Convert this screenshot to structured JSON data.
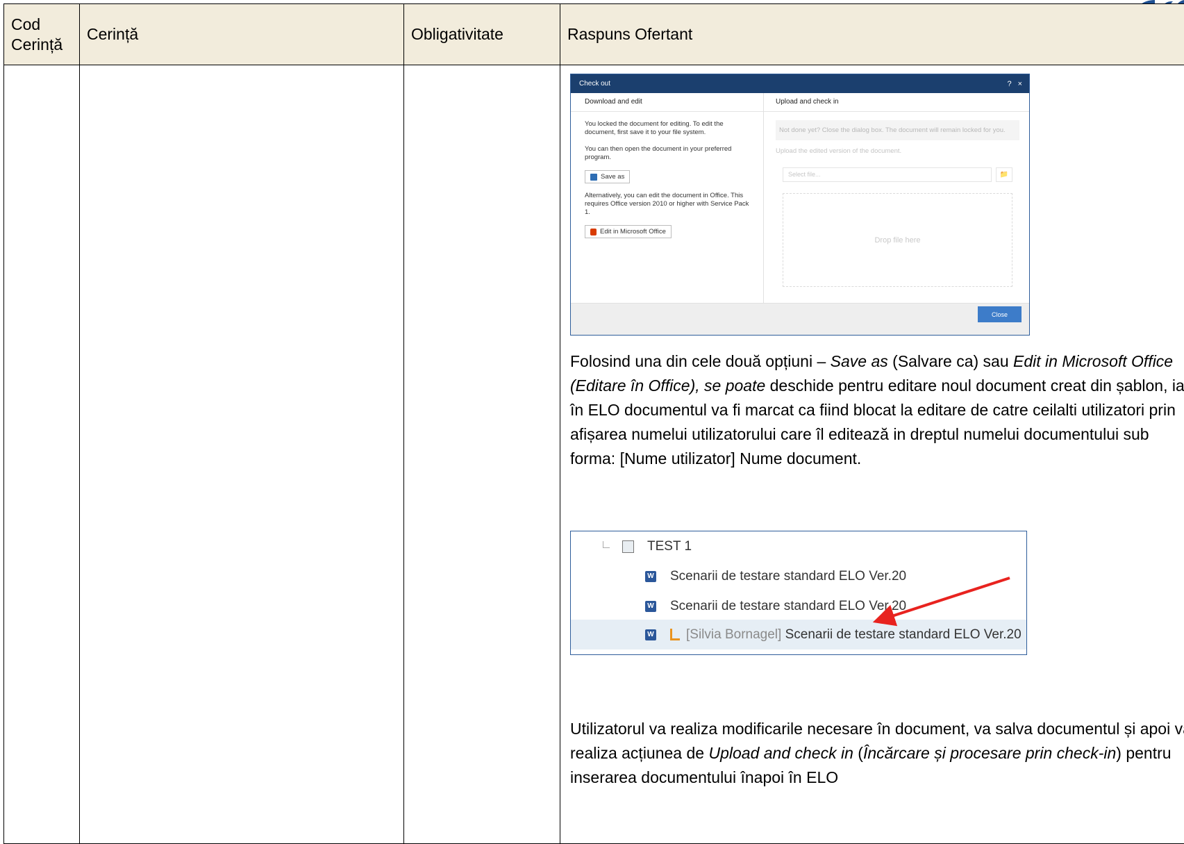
{
  "table": {
    "headers": [
      "Cod Cerință",
      "Cerință",
      "Obligativitate",
      "Raspuns Ofertant"
    ]
  },
  "checkout_dialog": {
    "title": "Check out",
    "title_controls": [
      "?",
      "×"
    ],
    "left_header": "Download and edit",
    "left_text_1": "You locked the document for editing. To edit the document, first save it to your file system.",
    "left_text_2": "You can then open the document in your preferred program.",
    "save_as_label": "Save as",
    "left_text_3": "Alternatively, you can edit the document in Office. This requires Office version 2010 or higher with Service Pack 1.",
    "edit_office_label": "Edit in Microsoft Office",
    "right_header": "Upload and check in",
    "right_hint": "Not done yet? Close the dialog box. The document will remain locked for you.",
    "upload_hint": "Upload the edited version of the document.",
    "select_placeholder": "Select file...",
    "drop_text": "Drop file here",
    "close_label": "Close"
  },
  "paragraph_1": {
    "t1": "Folosind una din cele două opțiuni – ",
    "i1": "Save as",
    "t2": " (Salvare ca) sau ",
    "i2": "Edit in Microsoft Office (Editare în Office), se poate",
    "t3": " deschide pentru editare noul document creat din șablon, iar în ELO documentul va fi marcat ca fiind blocat la editare de catre ceilalti utilizatori prin afișarea numelui utilizatorului care îl editează in dreptul numelui documentului sub forma: [Nume utilizator] Nume document."
  },
  "tree": {
    "folder": "TEST 1",
    "doc_1": "Scenarii de testare standard ELO Ver.20",
    "doc_2": "Scenarii de testare standard ELO Ver.20",
    "locked_user": "[Silvia Bornagel]",
    "doc_3": "Scenarii de testare standard ELO Ver.20",
    "word_icon_letter": "W",
    "arrow_color": "#e8231f"
  },
  "paragraph_2": {
    "t1": "Utilizatorul va realiza modificarile necesare în document, va salva documentul și apoi va realiza acțiunea de ",
    "i1": "Upload and check in",
    "t2": " (",
    "i2": "Încărcare și procesare prin check-in",
    "t3": ") pentru inserarea documentului înapoi în ELO"
  }
}
